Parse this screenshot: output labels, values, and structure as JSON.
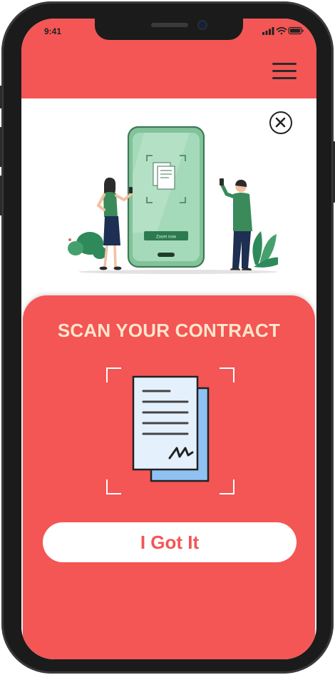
{
  "status_bar": {
    "time": "9:41"
  },
  "header": {
    "menu_icon": "hamburger-menu-icon",
    "background_color": "#f45555"
  },
  "illustration": {
    "close_icon": "close-circle-icon",
    "phone_button_text": "Zoom now"
  },
  "scan_card": {
    "title": "SCAN YOUR CONTRACT",
    "icon": "scan-document-icon",
    "button_label": "I Got It",
    "background_color": "#f45555",
    "title_color": "#ffe6cc"
  }
}
